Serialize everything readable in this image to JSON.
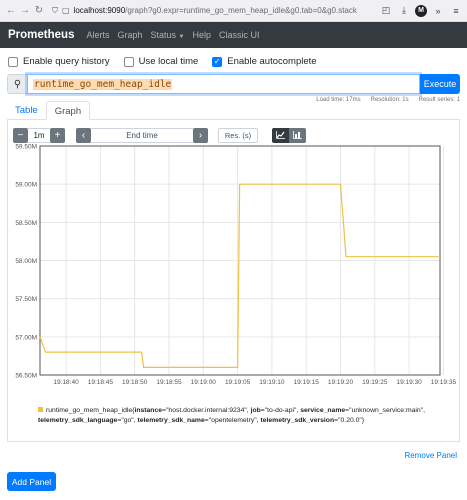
{
  "browser": {
    "url_host": "localhost:9090",
    "url_rest": "/graph?g0.expr=runtime_go_mem_heap_idle&g0.tab=0&g0.stack",
    "avatar_letter": "M"
  },
  "navbar": {
    "brand": "Prometheus",
    "links": [
      "Alerts",
      "Graph",
      "Status",
      "Help",
      "Classic UI"
    ]
  },
  "options": {
    "query_history": {
      "label": "Enable query history",
      "checked": false
    },
    "local_time": {
      "label": "Use local time",
      "checked": false
    },
    "autocomplete": {
      "label": "Enable autocomplete",
      "checked": true
    }
  },
  "expression": {
    "value": "runtime_go_mem_heap_idle",
    "execute_label": "Execute"
  },
  "stats": {
    "load_time": "Load time: 17ms",
    "resolution": "Resolution: 1s",
    "result_series": "Result series: 1"
  },
  "tabs": [
    "Table",
    "Graph"
  ],
  "controls": {
    "minus": "−",
    "range": "1m",
    "plus": "+",
    "prev": "‹",
    "end_time": "End time",
    "next": "›",
    "resolution_placeholder": "Res. (s)"
  },
  "legend": {
    "metric": "runtime_go_mem_heap_idle",
    "labels": [
      {
        "key": "instance",
        "value": "\"host.docker.internal:9234\""
      },
      {
        "key": "job",
        "value": "\"to-do-api\""
      },
      {
        "key": "service_name",
        "value": "\"unknown_service:main\""
      },
      {
        "key": "telemetry_sdk_language",
        "value": "\"go\""
      },
      {
        "key": "telemetry_sdk_name",
        "value": "\"opentelemetry\""
      },
      {
        "key": "telemetry_sdk_version",
        "value": "\"0.20.0\""
      }
    ]
  },
  "remove_panel": "Remove Panel",
  "add_panel": "Add Panel",
  "colors": {
    "series": "#edc240",
    "primary": "#007bff",
    "navbar": "#343a40"
  },
  "chart_data": {
    "type": "line",
    "x_tick_labels": [
      "19:18:40",
      "19:18:45",
      "19:18:50",
      "19:18:55",
      "19:19:00",
      "19:19:05",
      "19:19:10",
      "19:19:15",
      "19:19:20",
      "19:19:25",
      "19:19:30",
      "19:19:35"
    ],
    "x_range_seconds": [
      -3.8,
      54.5
    ],
    "y_tick_labels": [
      "56.50M",
      "57.00M",
      "57.50M",
      "58.00M",
      "58.50M",
      "59.00M",
      "59.50M"
    ],
    "ylim": [
      56.5,
      59.5
    ],
    "y_unit": "M",
    "grid": true,
    "series": [
      {
        "name": "runtime_go_mem_heap_idle{instance=\"host.docker.internal:9234\", job=\"to-do-api\", service_name=\"unknown_service:main\", telemetry_sdk_language=\"go\", telemetry_sdk_name=\"opentelemetry\", telemetry_sdk_version=\"0.20.0\"}",
        "color": "#edc240",
        "x_seconds": [
          -3.8,
          -3.0,
          11,
          11.3,
          25.0,
          25.3,
          40.0,
          40.8,
          54.5
        ],
        "y": [
          57.0,
          56.8,
          56.8,
          56.6,
          56.6,
          59.0,
          59.0,
          58.05,
          58.05
        ]
      }
    ]
  }
}
